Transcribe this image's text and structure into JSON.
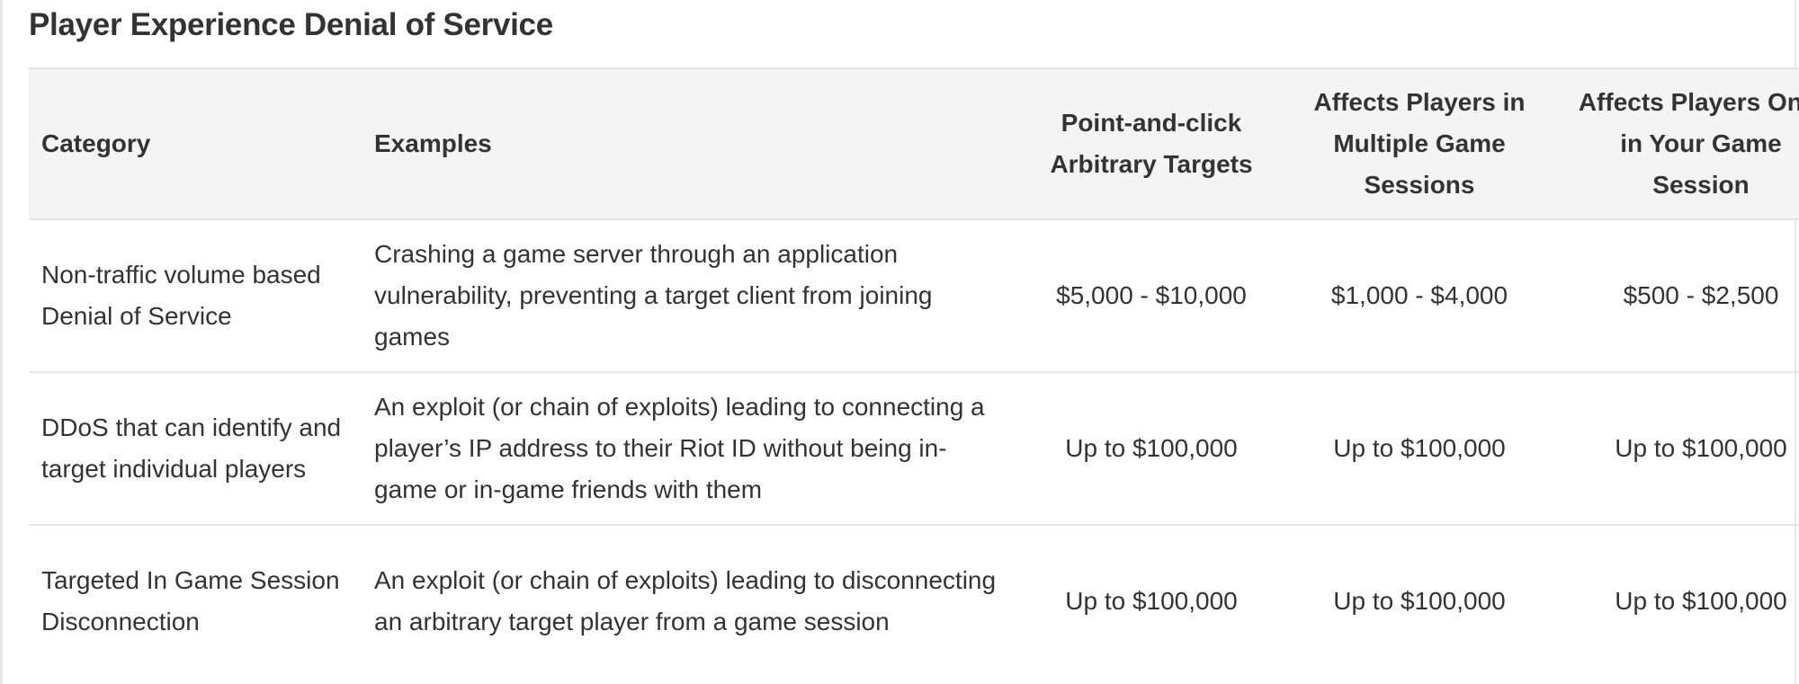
{
  "section": {
    "title": "Player Experience Denial of Service"
  },
  "table": {
    "headers": [
      "Category",
      "Examples",
      "Point-and-click Arbitrary Targets",
      "Affects Players in Multiple Game Sessions",
      "Affects Players Only in Your Game Session"
    ],
    "rows": [
      {
        "category": "Non-traffic volume based Denial of Service",
        "examples": "Crashing a game server through an application vulnerability, preventing a target client from joining games",
        "point_and_click": "$5,000 - $10,000",
        "multiple_sessions": "$1,000 - $4,000",
        "your_session": "$500 - $2,500"
      },
      {
        "category": "DDoS that can identify and target individual players",
        "examples": "An exploit (or chain of exploits) leading to connecting a player’s IP address to their Riot ID without being in-game or in-game friends with them",
        "point_and_click": "Up to $100,000",
        "multiple_sessions": "Up to $100,000",
        "your_session": "Up to $100,000"
      },
      {
        "category": "Targeted In Game Session Disconnection",
        "examples": "An exploit (or chain of exploits) leading to disconnecting an arbitrary target player from a game session",
        "point_and_click": "Up to $100,000",
        "multiple_sessions": "Up to $100,000",
        "your_session": "Up to $100,000"
      }
    ]
  },
  "colors": {
    "text": "#333333",
    "header_background": "#f4f4f4",
    "border": "#e4e4e4"
  }
}
